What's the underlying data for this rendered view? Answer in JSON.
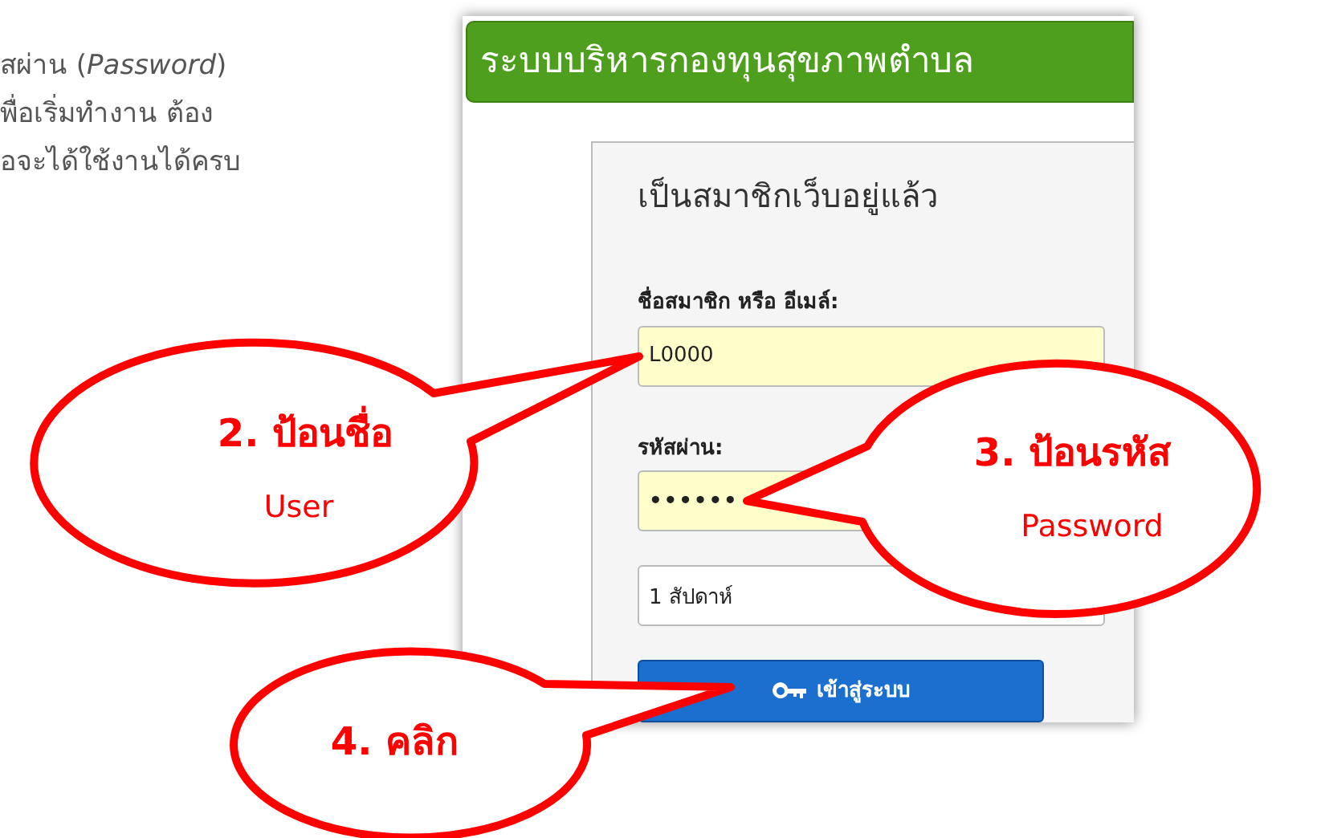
{
  "intro_lines": [
    "สผ่าน (*Password*)",
    "พื่อเริ่มทำงาน ต้อง",
    "อจะได้ใช้งานได้ครบ"
  ],
  "app": {
    "title": "ระบบบริหารกองทุนสุขภาพตำบล",
    "panel_title": "เป็นสมาชิกเว็บอยู่แล้ว",
    "fields": [
      {
        "kind": "text",
        "label": "ชื่อสมาชิก หรือ อีเมล์:",
        "value": "L0000"
      },
      {
        "kind": "password",
        "label": "รหัสผ่าน:",
        "value": "••••••"
      },
      {
        "kind": "select",
        "value": "1 สัปดาห์"
      }
    ],
    "login_button": "เข้าสู่ระบบ"
  },
  "callouts": [
    {
      "title": "2. ป้อนชื่อ",
      "subtitle": "User"
    },
    {
      "title": "3. ป้อนรหัส",
      "subtitle": "Password"
    },
    {
      "title": "4. คลิก"
    }
  ]
}
